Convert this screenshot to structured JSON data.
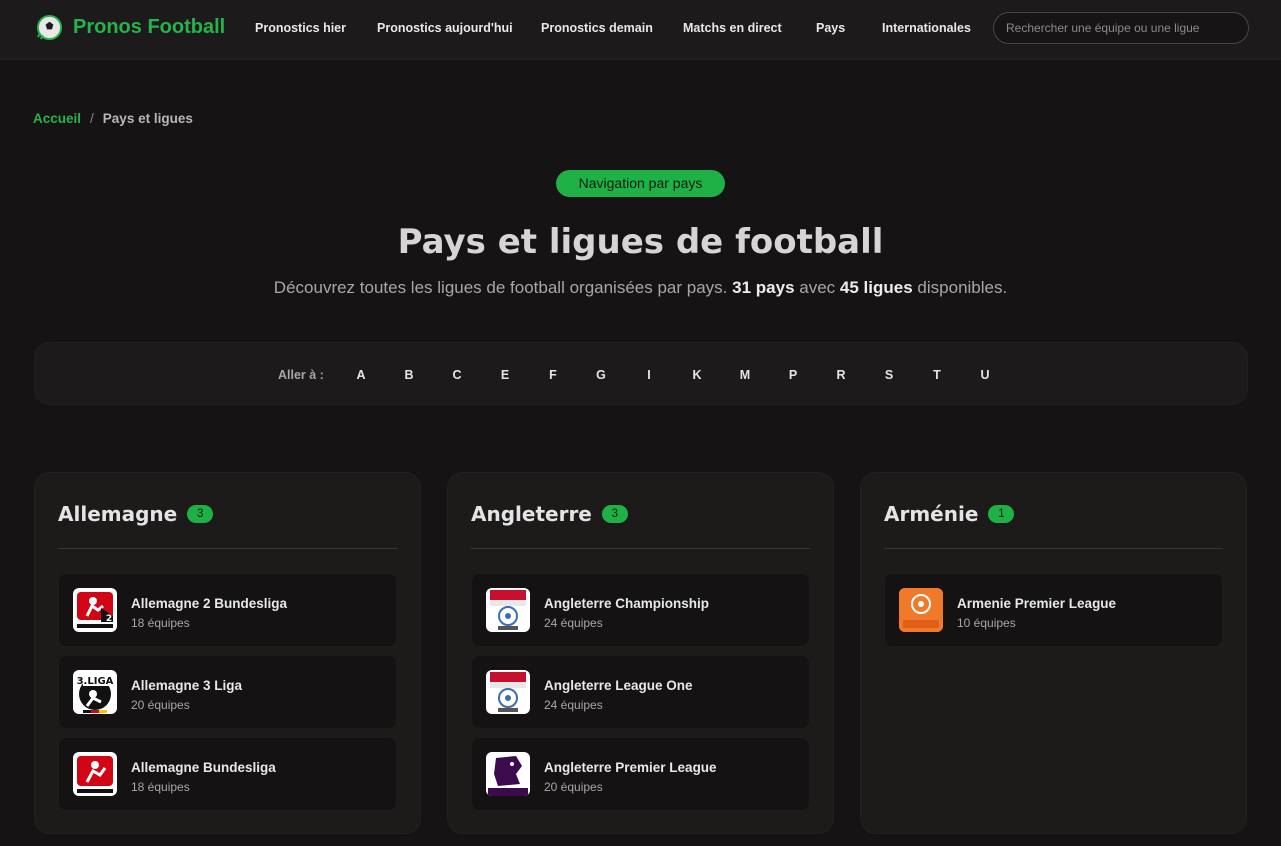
{
  "header": {
    "brand": "Pronos Football",
    "nav": [
      {
        "label": "Pronostics hier"
      },
      {
        "label": "Pronostics aujourd'hui"
      },
      {
        "label": "Pronostics demain"
      },
      {
        "label": "Matchs en direct"
      },
      {
        "label": "Pays"
      },
      {
        "label": "Internationales"
      }
    ],
    "search_placeholder": "Rechercher une équipe ou une ligue"
  },
  "breadcrumb": {
    "home": "Accueil",
    "separator": "/",
    "current": "Pays et ligues"
  },
  "hero": {
    "pill": "Navigation par pays",
    "title": "Pays et ligues de football",
    "subtitle_pre": "Découvrez toutes les ligues de football organisées par pays.",
    "countries_count": "31 pays",
    "subtitle_mid": "avec",
    "leagues_count": "45 ligues",
    "subtitle_post": "disponibles."
  },
  "alphabet": {
    "label": "Aller à :",
    "letters": [
      "A",
      "B",
      "C",
      "E",
      "F",
      "G",
      "I",
      "K",
      "M",
      "P",
      "R",
      "S",
      "T",
      "U"
    ]
  },
  "countries": [
    {
      "name": "Allemagne",
      "count": "3",
      "leagues": [
        {
          "name": "Allemagne 2 Bundesliga",
          "teams": "18 équipes",
          "logo": "bundesliga-2-logo"
        },
        {
          "name": "Allemagne 3 Liga",
          "teams": "20 équipes",
          "logo": "3-liga-logo"
        },
        {
          "name": "Allemagne Bundesliga",
          "teams": "18 équipes",
          "logo": "bundesliga-logo"
        }
      ]
    },
    {
      "name": "Angleterre",
      "count": "3",
      "leagues": [
        {
          "name": "Angleterre Championship",
          "teams": "24 équipes",
          "logo": "efl-championship-logo"
        },
        {
          "name": "Angleterre League One",
          "teams": "24 équipes",
          "logo": "efl-league-one-logo"
        },
        {
          "name": "Angleterre Premier League",
          "teams": "20 équipes",
          "logo": "premier-league-logo"
        }
      ]
    },
    {
      "name": "Arménie",
      "count": "1",
      "leagues": [
        {
          "name": "Armenie Premier League",
          "teams": "10 équipes",
          "logo": "idbank-logo"
        }
      ]
    }
  ],
  "colors": {
    "accent": "#25b34b",
    "background": "#151313",
    "card": "#1d1a1a"
  }
}
